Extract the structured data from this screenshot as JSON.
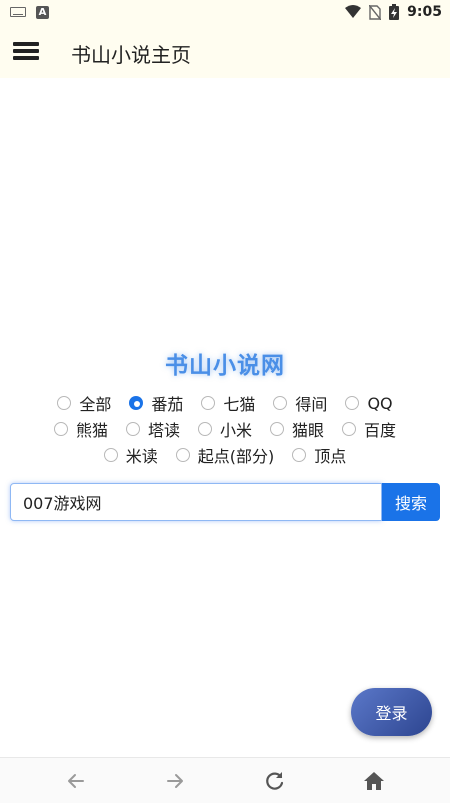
{
  "status_bar": {
    "time": "9:05",
    "left_icons": [
      "keyboard-icon",
      "a-notification-icon"
    ],
    "right_icons": [
      "wifi-icon",
      "no-sim-icon",
      "battery-charging-icon"
    ],
    "a_badge": "A"
  },
  "app_bar": {
    "title": "书山小说主页",
    "menu_icon": "hamburger-menu-icon"
  },
  "logo_text": "书山小说网",
  "sources": {
    "row1": [
      {
        "label": "全部",
        "checked": false
      },
      {
        "label": "番茄",
        "checked": true
      },
      {
        "label": "七猫",
        "checked": false
      },
      {
        "label": "得间",
        "checked": false
      },
      {
        "label": "QQ",
        "checked": false
      }
    ],
    "row2": [
      {
        "label": "熊猫",
        "checked": false
      },
      {
        "label": "塔读",
        "checked": false
      },
      {
        "label": "小米",
        "checked": false
      },
      {
        "label": "猫眼",
        "checked": false
      },
      {
        "label": "百度",
        "checked": false
      }
    ],
    "row3": [
      {
        "label": "米读",
        "checked": false
      },
      {
        "label": "起点(部分)",
        "checked": false
      },
      {
        "label": "顶点",
        "checked": false
      }
    ]
  },
  "search": {
    "value": "007游戏网",
    "button_label": "搜索"
  },
  "login_label": "登录",
  "bottom_nav": [
    "back-arrow-icon",
    "forward-arrow-icon",
    "refresh-icon",
    "home-icon"
  ],
  "colors": {
    "accent": "#1a73e8",
    "logo": "#4a8fe7",
    "appbar_bg": "#fffdf0",
    "login_gradient_start": "#5b78c9",
    "login_gradient_end": "#2d4590"
  }
}
